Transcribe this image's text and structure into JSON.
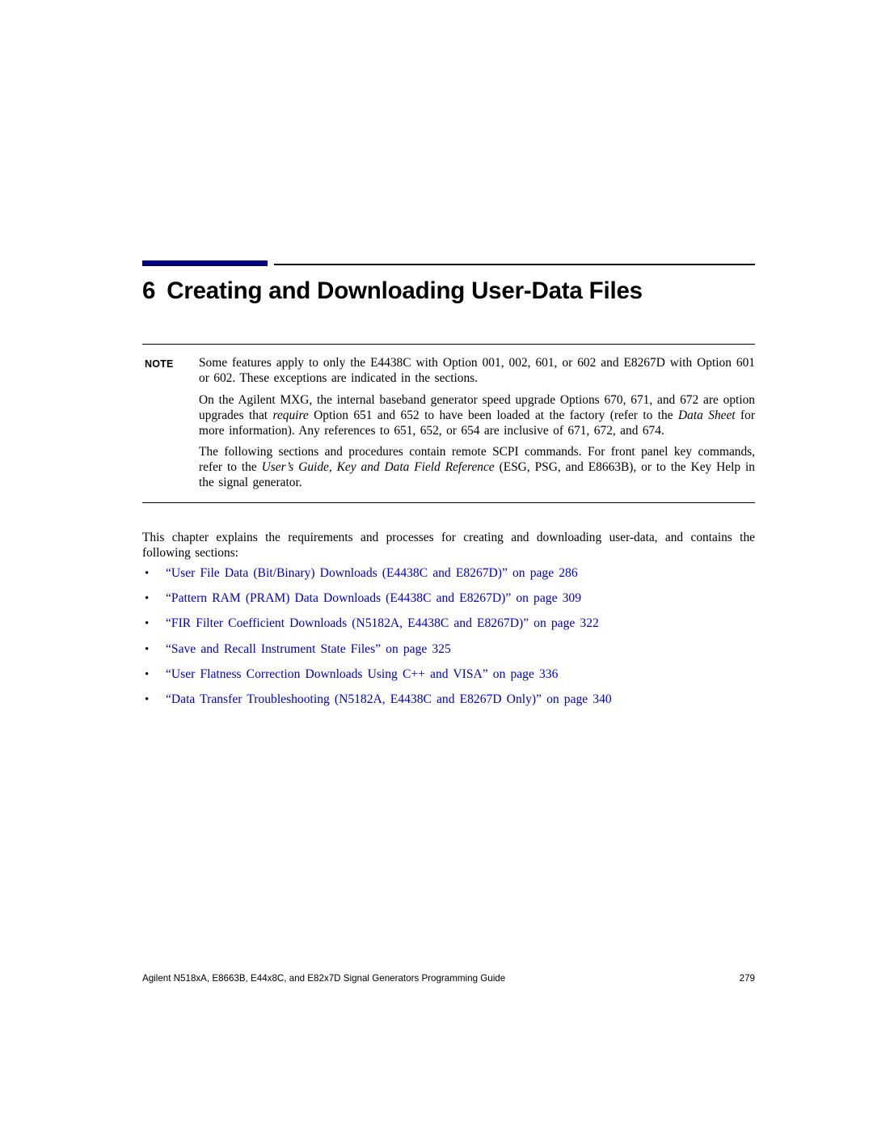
{
  "chapter": {
    "number": "6",
    "title": "Creating and Downloading User-Data Files"
  },
  "note": {
    "label": "NOTE",
    "paragraph1": "Some features apply to only the E4438C with Option 001, 002, 601, or 602 and E8267D with Option 601 or 602. These exceptions are indicated in the sections.",
    "paragraph2_part1": "On the Agilent MXG, the internal baseband generator speed upgrade Options 670, 671, and 672 are option upgrades that ",
    "paragraph2_italic1": "require",
    "paragraph2_part2": " Option 651 and 652 to have been loaded at the factory (refer to the ",
    "paragraph2_italic2": "Data Sheet",
    "paragraph2_part3": " for more information). Any references to 651, 652, or 654 are inclusive of 671, 672, and 674.",
    "paragraph3_part1": "The following sections and procedures contain remote SCPI commands. For front panel key commands, refer to the ",
    "paragraph3_italic1": "User’s Guide, Key and Data Field Reference",
    "paragraph3_part2": " (ESG, PSG, and E8663B), or to the Key Help in the signal generator."
  },
  "intro": "This chapter explains the requirements and processes for creating and downloading user-data, and contains the following sections:",
  "bullets": [
    "“User File Data (Bit/Binary) Downloads (E4438C and E8267D)” on page 286",
    "“Pattern RAM (PRAM) Data Downloads (E4438C and E8267D)” on page 309",
    "“FIR Filter Coefficient Downloads (N5182A, E4438C and E8267D)” on page 322",
    "“Save and Recall Instrument State Files” on page 325",
    "“User Flatness Correction Downloads Using C++ and VISA” on page 336",
    "“Data Transfer Troubleshooting (N5182A, E4438C and E8267D Only)” on page 340"
  ],
  "bullet_marker": "•",
  "footer": {
    "left": "Agilent N518xA, E8663B, E44x8C, and E82x7D Signal Generators Programming Guide",
    "right": "279"
  },
  "colors": {
    "accent_rule": "#00007A",
    "link": "#0000C8"
  }
}
